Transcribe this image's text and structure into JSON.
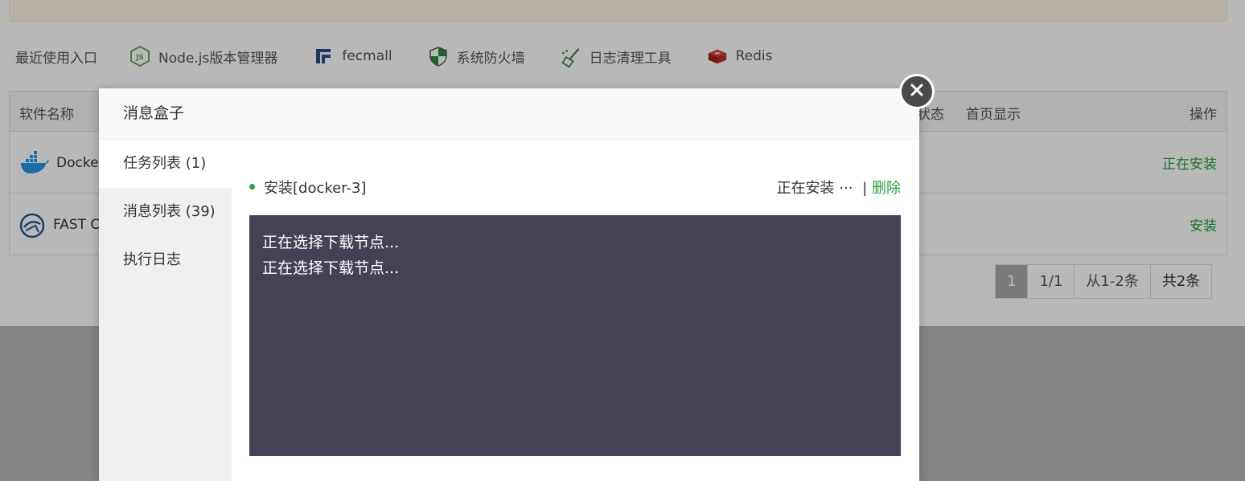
{
  "recent": {
    "label": "最近使用入口",
    "entries": [
      {
        "label": "Node.js版本管理器",
        "icon": "nodejs-icon"
      },
      {
        "label": "fecmall",
        "icon": "fecmall-icon"
      },
      {
        "label": "系统防火墙",
        "icon": "shield-icon"
      },
      {
        "label": "日志清理工具",
        "icon": "broom-icon"
      },
      {
        "label": "Redis",
        "icon": "redis-icon"
      }
    ]
  },
  "table": {
    "headers": {
      "name": "软件名称",
      "status": "状态",
      "home": "首页显示",
      "op": "操作"
    },
    "rows": [
      {
        "name": "Docke",
        "op": "正在安装",
        "icon": "docker-icon"
      },
      {
        "name": "FAST C",
        "op": "安装",
        "icon": "fastcgi-icon"
      }
    ]
  },
  "pager": {
    "current": "1",
    "pages": "1/1",
    "range": "从1-2条",
    "total": "共2条"
  },
  "dialog": {
    "title": "消息盒子",
    "tabs": [
      "任务列表 (1)",
      "消息列表 (39)",
      "执行日志"
    ],
    "task": {
      "name": "安装[docker-3]",
      "status": "正在安装",
      "ellipsis": "···",
      "sep": "|",
      "delete": "删除"
    },
    "log_lines": [
      "正在选择下载节点...",
      "正在选择下载节点..."
    ]
  },
  "colors": {
    "accent": "#20a53a",
    "log_bg": "#444354"
  }
}
